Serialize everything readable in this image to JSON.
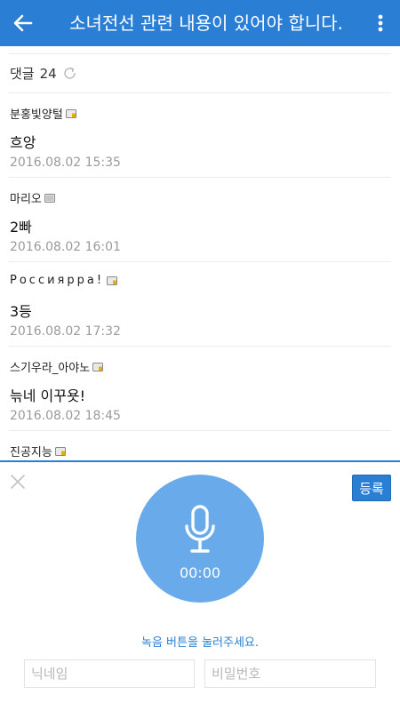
{
  "appbar": {
    "title": "소녀전선 관련 내용이 있어야 합니다.",
    "back_icon": "arrow-left-icon",
    "more_icon": "more-vertical-icon"
  },
  "comments_header": {
    "label": "댓글",
    "count": "24",
    "refresh_icon": "refresh-icon"
  },
  "comments": [
    {
      "nickname": "분홍빛양털",
      "text": "흐앙",
      "time": "2016.08.02 15:35"
    },
    {
      "nickname": "마리오",
      "text": "2빠",
      "time": "2016.08.02 16:01"
    },
    {
      "nickname": "Россиярра!",
      "text": "3등",
      "time": "2016.08.02 17:32"
    },
    {
      "nickname": "스기우라_아야노",
      "text": "늒네 이꾸욧!",
      "time": "2016.08.02 18:45"
    },
    {
      "nickname": "진공지능",
      "text": "",
      "time": ""
    }
  ],
  "recorder": {
    "timer": "00:00",
    "hint": "녹음 버튼을 눌러주세요.",
    "register_label": "등록",
    "nickname_placeholder": "닉네임",
    "password_placeholder": "비밀번호",
    "mic_icon": "microphone-icon",
    "close_icon": "close-icon"
  },
  "colors": {
    "primary": "#2a7fd4",
    "mic_circle": "#69aaea",
    "time_text": "#9a9a9a",
    "divider": "#ececec"
  }
}
